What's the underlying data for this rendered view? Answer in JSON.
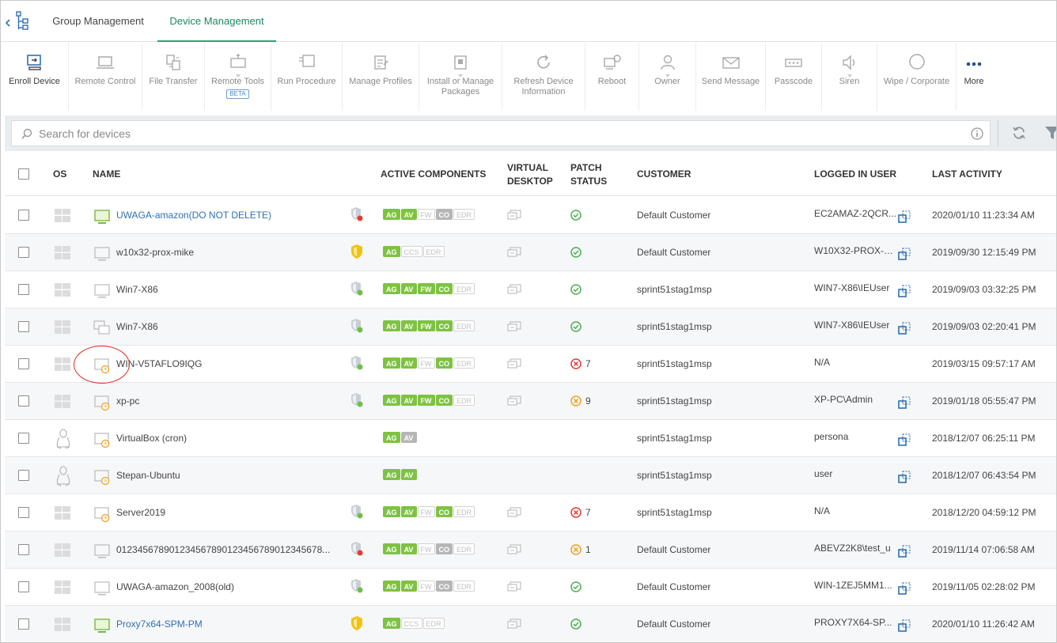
{
  "tabs": [
    {
      "label": "Group Management",
      "active": false
    },
    {
      "label": "Device Management",
      "active": true
    }
  ],
  "toolbar": {
    "enroll_device": "Enroll Device",
    "remote_control": "Remote Control",
    "file_transfer": "File Transfer",
    "remote_tools": "Remote Tools",
    "remote_tools_badge": "BETA",
    "run_procedure": "Run Procedure",
    "manage_profiles": "Manage Profiles",
    "install_packages_1": "Install or Manage",
    "install_packages_2": "Packages",
    "refresh_info_1": "Refresh Device",
    "refresh_info_2": "Information",
    "reboot": "Reboot",
    "owner": "Owner",
    "send_message": "Send Message",
    "passcode": "Passcode",
    "siren": "Siren",
    "wipe": "Wipe / Corporate",
    "more": "More"
  },
  "search": {
    "placeholder": "Search for devices"
  },
  "table": {
    "headers": {
      "os": "OS",
      "name": "NAME",
      "active_components": "ACTIVE COMPONENTS",
      "virtual_desktop_1": "VIRTUAL",
      "virtual_desktop_2": "DESKTOP",
      "patch_status_1": "PATCH",
      "patch_status_2": "STATUS",
      "customer": "CUSTOMER",
      "logged_in_user": "LOGGED IN USER",
      "last_activity": "LAST ACTIVITY"
    },
    "rows": [
      {
        "name": "UWAGA-amazon(DO NOT DELETE)",
        "customer": "Default Customer",
        "user": "EC2AMAZ-2QCR...",
        "last": "2020/01/10 11:23:34 AM",
        "patch_count": ""
      },
      {
        "name": "w10x32-prox-mike",
        "customer": "Default Customer",
        "user": "W10X32-PROX-M...",
        "last": "2019/09/30 12:15:49 PM",
        "patch_count": ""
      },
      {
        "name": "Win7-X86",
        "customer": "sprint51stag1msp",
        "user": "WIN7-X86\\IEUser",
        "last": "2019/09/03 03:32:25 PM",
        "patch_count": ""
      },
      {
        "name": "Win7-X86",
        "customer": "sprint51stag1msp",
        "user": "WIN7-X86\\IEUser",
        "last": "2019/09/03 02:20:41 PM",
        "patch_count": ""
      },
      {
        "name": "WIN-V5TAFLO9IQG",
        "customer": "sprint51stag1msp",
        "user": "N/A",
        "last": "2019/03/15 09:57:17 AM",
        "patch_count": "7"
      },
      {
        "name": "xp-pc",
        "customer": "sprint51stag1msp",
        "user": "XP-PC\\Admin",
        "last": "2019/01/18 05:55:47 PM",
        "patch_count": "9"
      },
      {
        "name": "VirtualBox (cron)",
        "customer": "sprint51stag1msp",
        "user": "persona",
        "last": "2018/12/07 06:25:11 PM",
        "patch_count": ""
      },
      {
        "name": "Stepan-Ubuntu",
        "customer": "sprint51stag1msp",
        "user": "user",
        "last": "2018/12/07 06:43:54 PM",
        "patch_count": ""
      },
      {
        "name": "Server2019",
        "customer": "sprint51stag1msp",
        "user": "N/A",
        "last": "2018/12/20 04:59:12 PM",
        "patch_count": "7"
      },
      {
        "name": "012345678901234567890123456789012345678...",
        "customer": "Default Customer",
        "user": "ABEVZ2K8\\test_u",
        "last": "2019/11/14 07:06:58 AM",
        "patch_count": "1"
      },
      {
        "name": "UWAGA-amazon_2008(old)",
        "customer": "Default Customer",
        "user": "WIN-1ZEJ5MM1...",
        "last": "2019/11/05 02:28:02 PM",
        "patch_count": ""
      },
      {
        "name": "Proxy7x64-SPM-PM",
        "customer": "Default Customer",
        "user": "PROXY7X64-SP...",
        "last": "2020/01/10 11:26:42 AM",
        "patch_count": ""
      }
    ],
    "badge_labels": {
      "ag": "AG",
      "av": "AV",
      "fw": "FW",
      "co": "CO",
      "edr": "EDR",
      "ccs": "CCS"
    }
  },
  "colors": {
    "accent": "#27a570",
    "link": "#2f6fb3",
    "badge_green": "#7ec242",
    "annotation_red": "#e0261c"
  }
}
